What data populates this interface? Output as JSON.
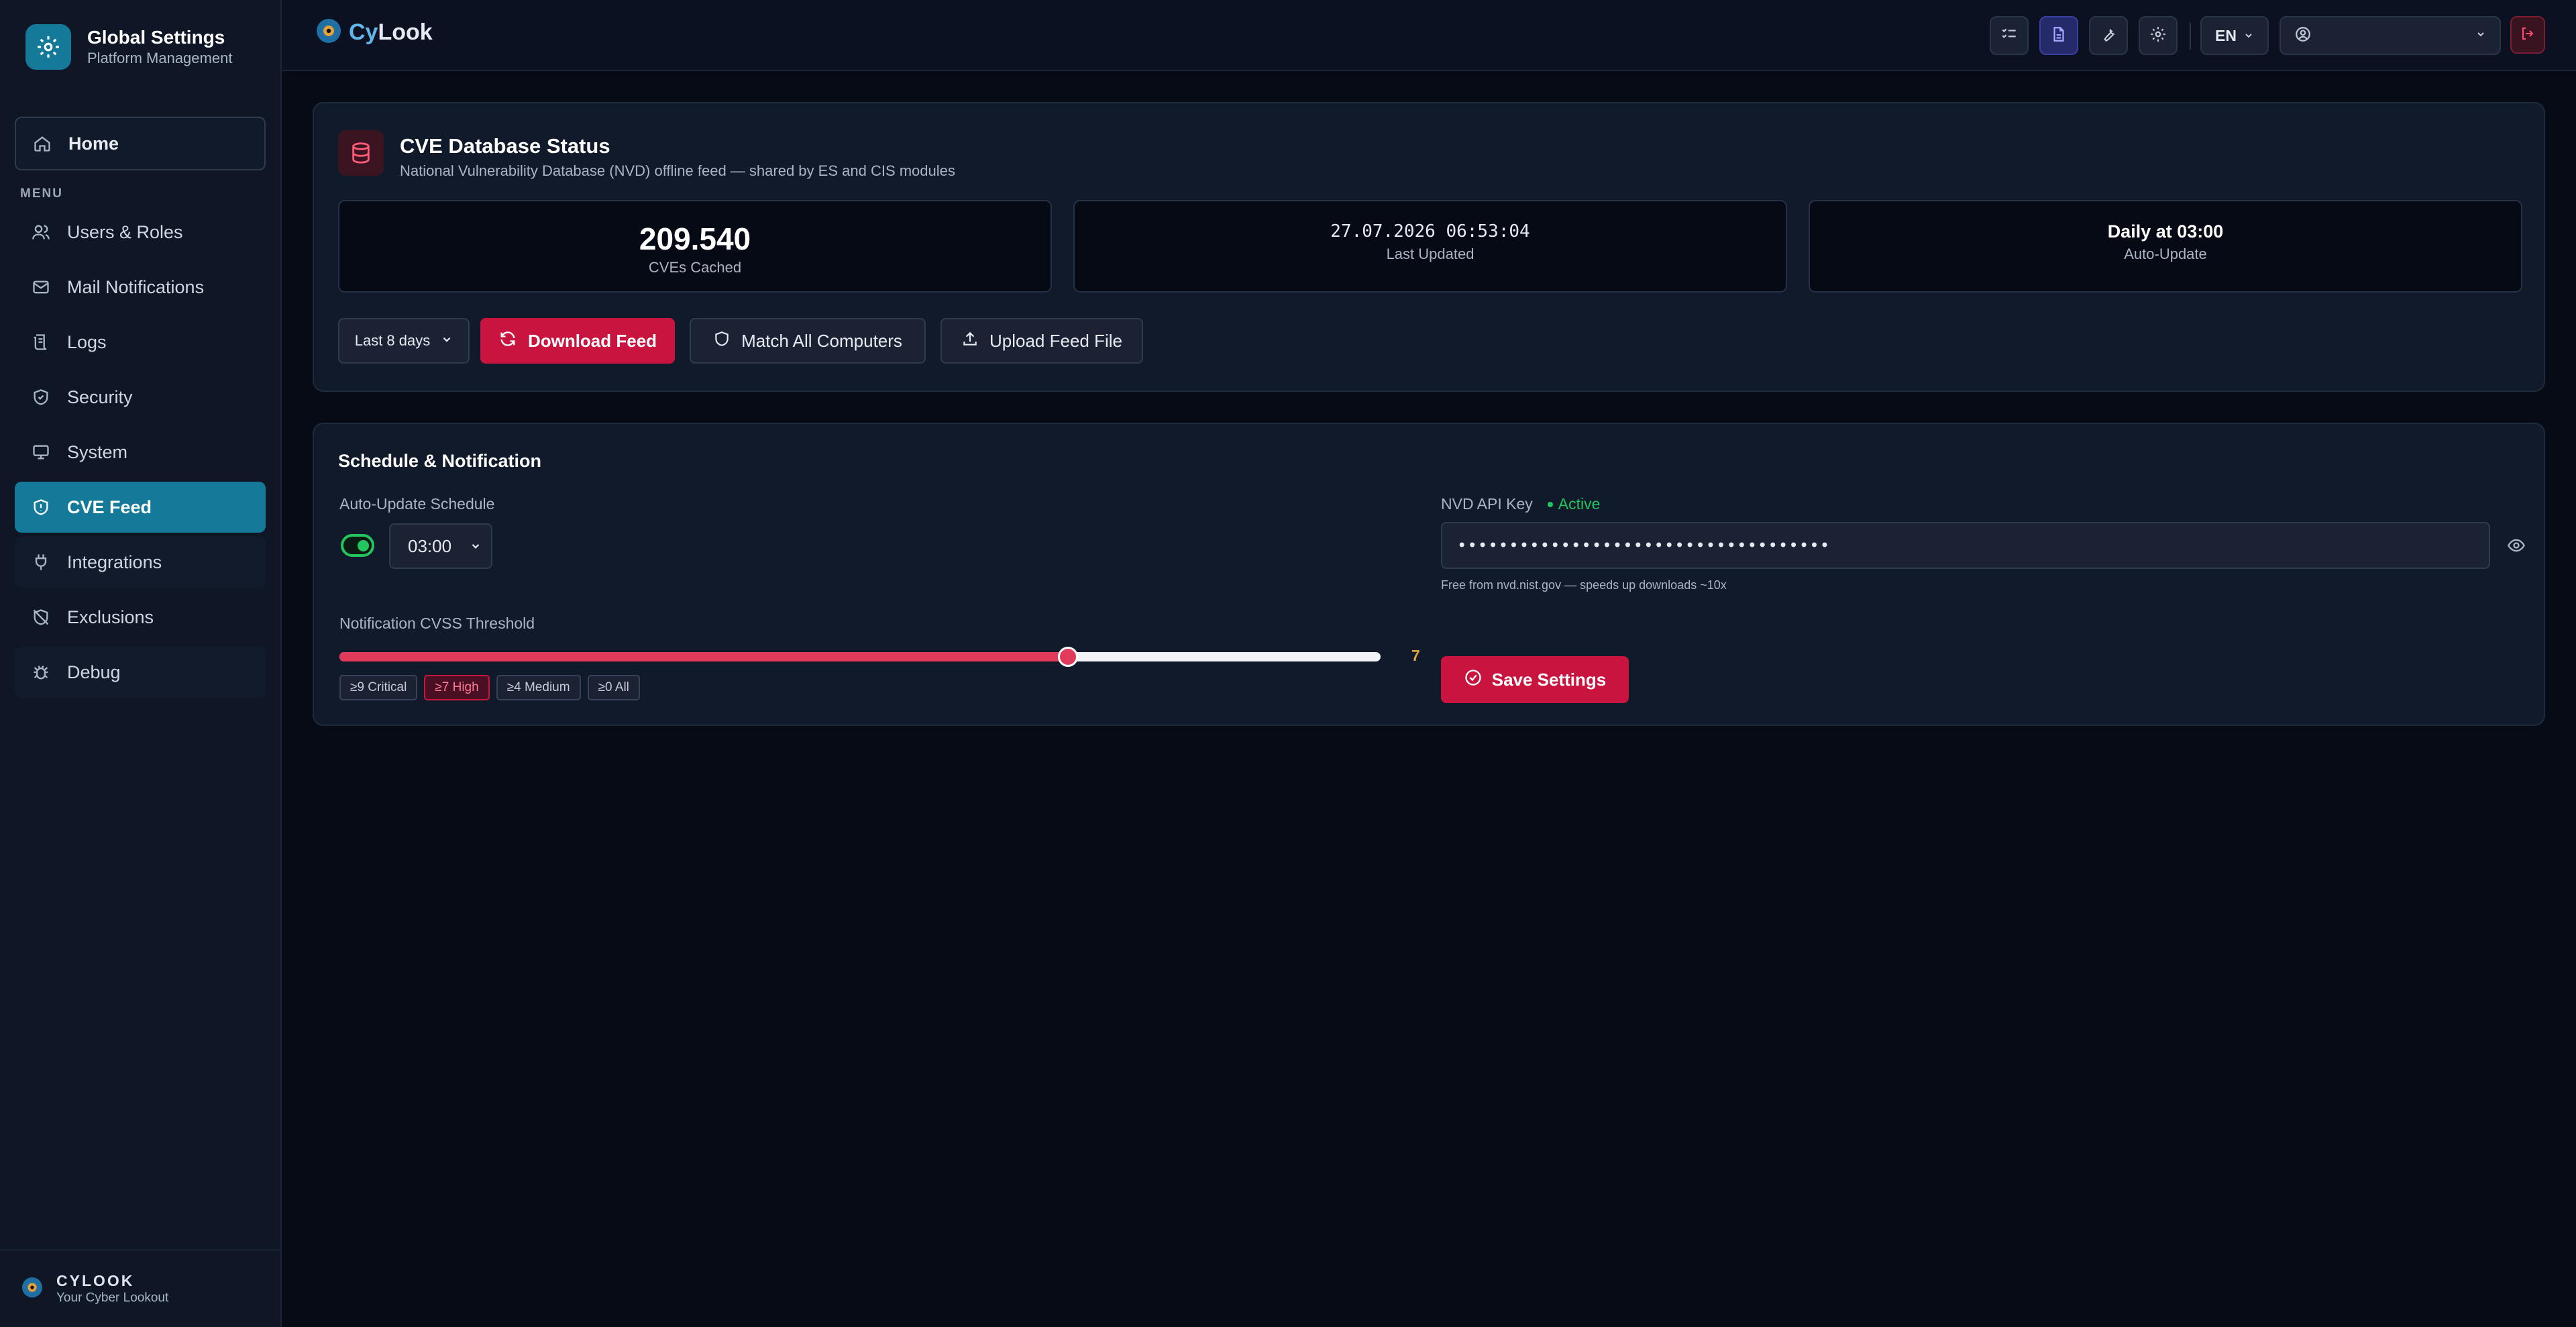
{
  "sidebar": {
    "brand": {
      "title": "Global Settings",
      "subtitle": "Platform Management"
    },
    "home_label": "Home",
    "menu_label": "MENU",
    "items": [
      {
        "label": "Users & Roles",
        "icon": "users-icon"
      },
      {
        "label": "Mail Notifications",
        "icon": "mail-icon"
      },
      {
        "label": "Logs",
        "icon": "logs-icon"
      },
      {
        "label": "Security",
        "icon": "shield-icon"
      },
      {
        "label": "System",
        "icon": "monitor-icon"
      },
      {
        "label": "CVE Feed",
        "icon": "shield-alert-icon",
        "active": true
      },
      {
        "label": "Integrations",
        "icon": "plug-icon"
      },
      {
        "label": "Exclusions",
        "icon": "shield-off-icon"
      },
      {
        "label": "Debug",
        "icon": "bug-icon"
      }
    ],
    "footer": {
      "title": "CYLOOK",
      "subtitle": "Your Cyber Lookout"
    }
  },
  "topbar": {
    "logo_cy": "Cy",
    "logo_look": "Look",
    "language": "EN",
    "icons": [
      "checklist-icon",
      "document-icon",
      "wrench-icon",
      "gear-icon",
      "user-circle-icon",
      "logout-icon"
    ]
  },
  "cve_status": {
    "title": "CVE Database Status",
    "subtitle": "National Vulnerability Database (NVD) offline feed — shared by ES and CIS modules",
    "stats": [
      {
        "value": "209.540",
        "label": "CVEs Cached"
      },
      {
        "value": "27.07.2026 06:53:04",
        "label": "Last Updated"
      },
      {
        "value": "Daily at 03:00",
        "label": "Auto-Update"
      }
    ],
    "range_select": "Last 8 days",
    "download_label": "Download Feed",
    "match_label": "Match All Computers",
    "upload_label": "Upload Feed File"
  },
  "schedule": {
    "title": "Schedule & Notification",
    "auto_update_label": "Auto-Update Schedule",
    "auto_update_enabled": true,
    "time_value": "03:00",
    "threshold_label": "Notification CVSS Threshold",
    "threshold_value": 7,
    "threshold_max": 10,
    "threshold_display": "7",
    "presets": [
      {
        "label": "≥9 Critical",
        "active": false
      },
      {
        "label": "≥7 High",
        "active": true
      },
      {
        "label": "≥4 Medium",
        "active": false
      },
      {
        "label": "≥0 All",
        "active": false
      }
    ],
    "api_key_label": "NVD API Key",
    "api_key_status": "Active",
    "api_key_value": "••••••••••••••••••••••••••••••••••••",
    "api_key_help": "Free from nvd.nist.gov — speeds up downloads ~10x",
    "save_label": "Save Settings"
  },
  "colors": {
    "accent": "#157a99",
    "primary": "#c8143f",
    "success": "#22c55e",
    "warning": "#e2a23a"
  }
}
